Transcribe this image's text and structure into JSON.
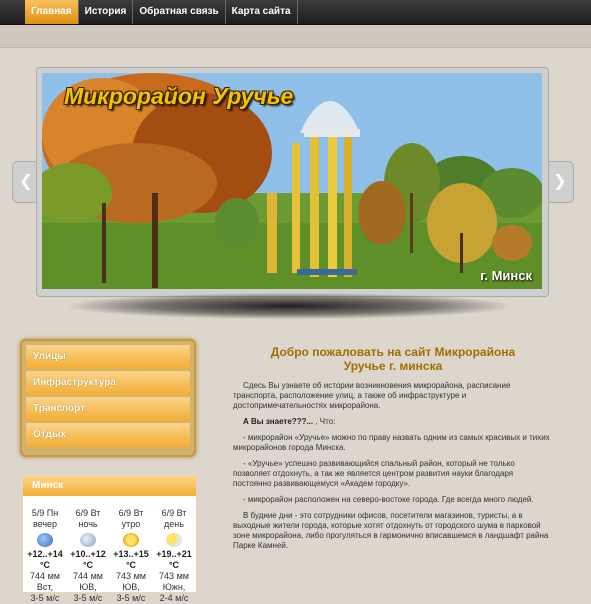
{
  "nav": {
    "items": [
      {
        "label": "Главная",
        "active": true
      },
      {
        "label": "История",
        "active": false
      },
      {
        "label": "Обратная связь",
        "active": false
      },
      {
        "label": "Карта сайта",
        "active": false
      }
    ]
  },
  "slider": {
    "title": "Микрорайон Уручье",
    "caption": "г. Минск",
    "prev_icon": "chevron-left-icon",
    "next_icon": "chevron-right-icon"
  },
  "menu": {
    "items": [
      {
        "label": "Улицы"
      },
      {
        "label": "Инфраструктура"
      },
      {
        "label": "Транспорт"
      },
      {
        "label": "Отдых"
      }
    ]
  },
  "weather": {
    "city": "Минск",
    "columns": [
      {
        "date": "5/9 Пн",
        "part": "вечер",
        "icon": "night-cloud-icon",
        "temp": "+12..+14",
        "unit": "°C",
        "pressure": "744 мм",
        "wind": "Вст,",
        "wind2": "3-5 м/с"
      },
      {
        "date": "6/9 Вт",
        "part": "ночь",
        "icon": "night-partly-cloudy-icon",
        "temp": "+10..+12",
        "unit": "°C",
        "pressure": "744 мм",
        "wind": "ЮВ,",
        "wind2": "3-5 м/с"
      },
      {
        "date": "6/9 Вт",
        "part": "утро",
        "icon": "sun-icon",
        "temp": "+13..+15",
        "unit": "°C",
        "pressure": "743 мм",
        "wind": "ЮВ,",
        "wind2": "3-5 м/с"
      },
      {
        "date": "6/9 Вт",
        "part": "день",
        "icon": "sun-cloud-icon",
        "temp": "+19..+21",
        "unit": "°C",
        "pressure": "743 мм",
        "wind": "Южн,",
        "wind2": "2-4 м/с"
      }
    ]
  },
  "content": {
    "heading_line1": "Добро пожаловать на сайт Микрорайона",
    "heading_line2": "Уручье г. минска",
    "p1": "Сдесь Вы узнаете об истории возникновения микрорайона, расписание транспорта, расположение улиц, а также об инфраструктуре и достопримечательностях микрорайона.",
    "p2_bold": "А Вы знаете???...",
    "p2_rest": " , Что:",
    "p3": "- микрорайон «Уручье» можно по праву назвать одним из самых красивых и тихих микрорайонов города Минска.",
    "p4": "- «Уручье» успешно развивающийся спальный район, который не только позволяет отдохнуть, а так же является центром развития науки благодаря постоянно развивающемуся «Академ городку».",
    "p5": "- микрорайон расположен на северо-востоке города. Где всегда много людей.",
    "p6": "В будние дни - это сотрудники офисов, посетители магазинов, туристы, а в выходные жители города, которые хотят отдохнуть от городского шума в парковой зоне микрорайона, либо прогуляться в гармонично вписавшемся в ландшафт райна Парке Камней."
  },
  "colors": {
    "accent": "#f2ae33",
    "heading": "#a06e00",
    "title": "#f4c200"
  }
}
